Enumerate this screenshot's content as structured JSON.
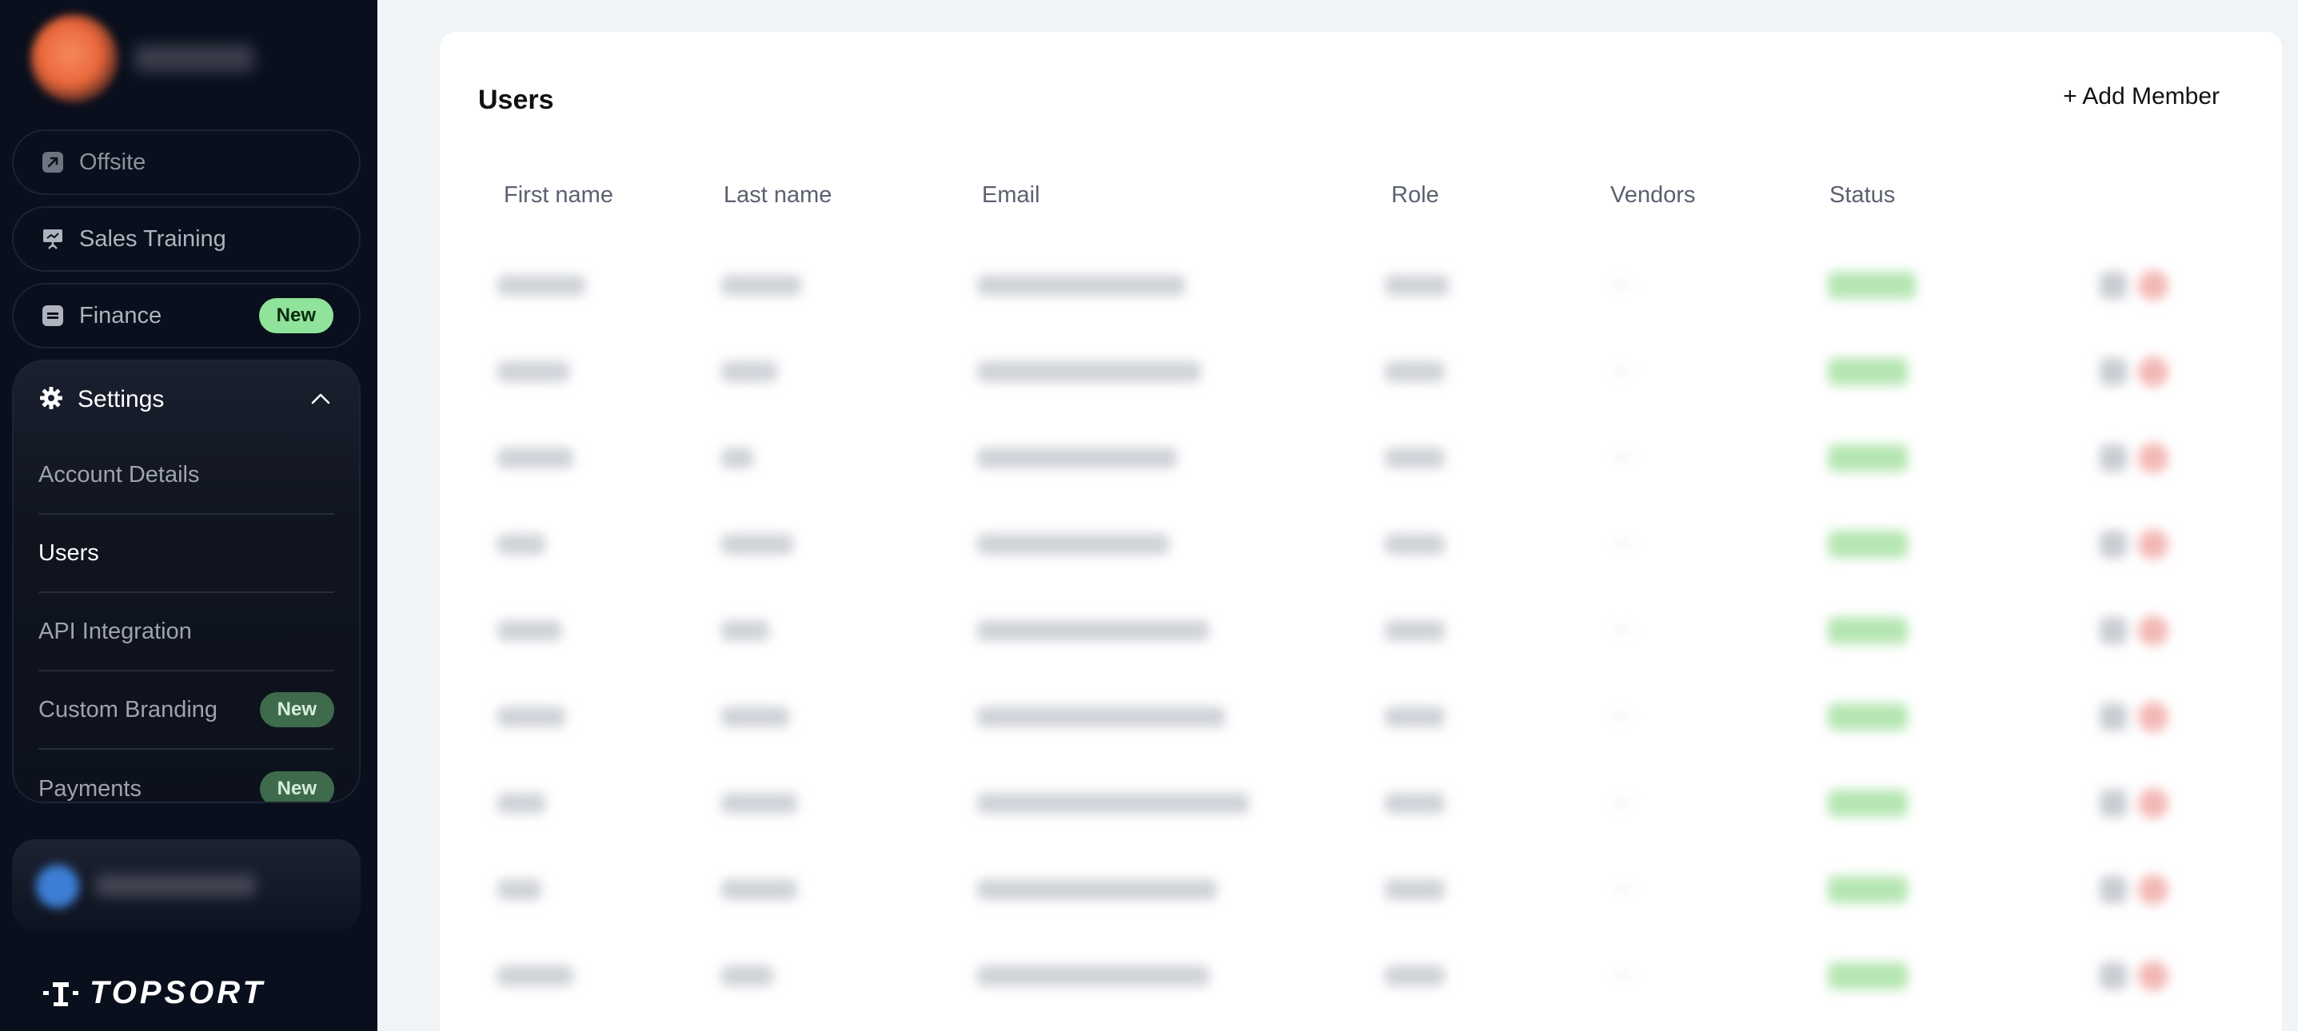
{
  "sidebar": {
    "nav": [
      {
        "label": "Offsite",
        "icon": "external-link-icon"
      },
      {
        "label": "Sales Training",
        "icon": "presentation-icon"
      },
      {
        "label": "Finance",
        "icon": "wallet-icon",
        "badge": "New"
      }
    ],
    "settings": {
      "title": "Settings",
      "icon": "gear-icon",
      "items": [
        {
          "label": "Account Details"
        },
        {
          "label": "Users",
          "active": true
        },
        {
          "label": "API Integration"
        },
        {
          "label": "Custom Branding",
          "badge": "New"
        },
        {
          "label": "Payments",
          "badge": "New"
        }
      ]
    },
    "logo_text": "TOPSORT"
  },
  "main": {
    "title": "Users",
    "add_button": "+ Add Member",
    "columns": [
      "First name",
      "Last name",
      "Email",
      "Role",
      "Vendors",
      "Status"
    ]
  },
  "colors": {
    "sidebar_bg": "#0a0f1d",
    "page_bg": "#f1f4f7",
    "badge_bright": "#8fe39a",
    "badge_muted": "#3e6b4b",
    "status_green": "#b5e6b2",
    "delete_red": "#f3b7b4"
  }
}
